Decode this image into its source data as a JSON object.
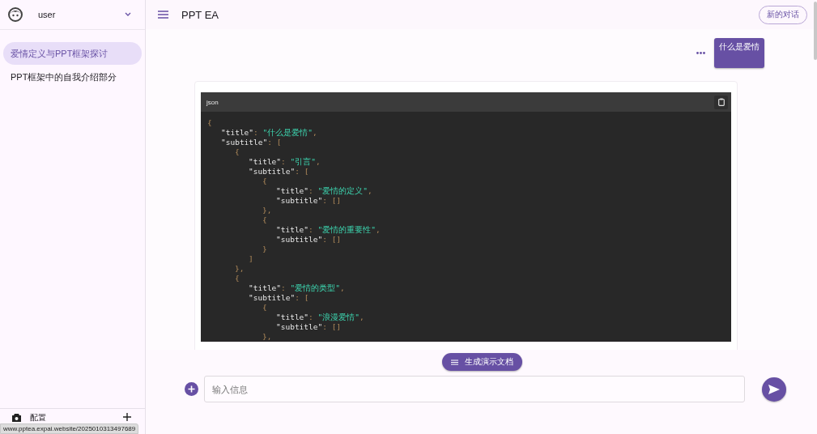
{
  "sidebar": {
    "user": "user",
    "conversations": [
      {
        "title": "爱情定义与PPT框架探讨",
        "selected": true
      },
      {
        "title": "PPT框架中的自我介绍部分",
        "selected": false
      }
    ],
    "settings_label": "配置"
  },
  "header": {
    "title": "PPT EA",
    "new_chat_button": "新的对话"
  },
  "user_message": "什么是爱情",
  "code_block": {
    "language": "json",
    "lines": [
      [
        {
          "kind": "punct",
          "text": "{"
        }
      ],
      [
        {
          "kind": "key",
          "text": "\"title\""
        },
        {
          "kind": "punct",
          "text": ": "
        },
        {
          "kind": "str",
          "text": "\"什么是爱情\""
        },
        {
          "kind": "punct",
          "text": ","
        }
      ],
      [
        {
          "kind": "key",
          "text": "\"subtitle\""
        },
        {
          "kind": "punct",
          "text": ": ["
        }
      ],
      [
        {
          "kind": "punct",
          "text": "{"
        }
      ],
      [
        {
          "kind": "key",
          "text": "\"title\""
        },
        {
          "kind": "punct",
          "text": ": "
        },
        {
          "kind": "str",
          "text": "\"引言\""
        },
        {
          "kind": "punct",
          "text": ","
        }
      ],
      [
        {
          "kind": "key",
          "text": "\"subtitle\""
        },
        {
          "kind": "punct",
          "text": ": ["
        }
      ],
      [
        {
          "kind": "punct",
          "text": "{"
        }
      ],
      [
        {
          "kind": "key",
          "text": "\"title\""
        },
        {
          "kind": "punct",
          "text": ": "
        },
        {
          "kind": "str",
          "text": "\"爱情的定义\""
        },
        {
          "kind": "punct",
          "text": ","
        }
      ],
      [
        {
          "kind": "key",
          "text": "\"subtitle\""
        },
        {
          "kind": "punct",
          "text": ": []"
        }
      ],
      [
        {
          "kind": "punct",
          "text": "},"
        }
      ],
      [
        {
          "kind": "punct",
          "text": "{"
        }
      ],
      [
        {
          "kind": "key",
          "text": "\"title\""
        },
        {
          "kind": "punct",
          "text": ": "
        },
        {
          "kind": "str",
          "text": "\"爱情的重要性\""
        },
        {
          "kind": "punct",
          "text": ","
        }
      ],
      [
        {
          "kind": "key",
          "text": "\"subtitle\""
        },
        {
          "kind": "punct",
          "text": ": []"
        }
      ],
      [
        {
          "kind": "punct",
          "text": "}"
        }
      ],
      [
        {
          "kind": "punct",
          "text": "]"
        }
      ],
      [
        {
          "kind": "punct",
          "text": "},"
        }
      ],
      [
        {
          "kind": "punct",
          "text": "{"
        }
      ],
      [
        {
          "kind": "key",
          "text": "\"title\""
        },
        {
          "kind": "punct",
          "text": ": "
        },
        {
          "kind": "str",
          "text": "\"爱情的类型\""
        },
        {
          "kind": "punct",
          "text": ","
        }
      ],
      [
        {
          "kind": "key",
          "text": "\"subtitle\""
        },
        {
          "kind": "punct",
          "text": ": ["
        }
      ],
      [
        {
          "kind": "punct",
          "text": "{"
        }
      ],
      [
        {
          "kind": "key",
          "text": "\"title\""
        },
        {
          "kind": "punct",
          "text": ": "
        },
        {
          "kind": "str",
          "text": "\"浪漫爱情\""
        },
        {
          "kind": "punct",
          "text": ","
        }
      ],
      [
        {
          "kind": "key",
          "text": "\"subtitle\""
        },
        {
          "kind": "punct",
          "text": ": []"
        }
      ],
      [
        {
          "kind": "punct",
          "text": "},"
        }
      ]
    ]
  },
  "generate_button": "生成演示文档",
  "input": {
    "placeholder": "输入信息"
  },
  "status_url": "www.pptea.expai.website/2025010313497689"
}
